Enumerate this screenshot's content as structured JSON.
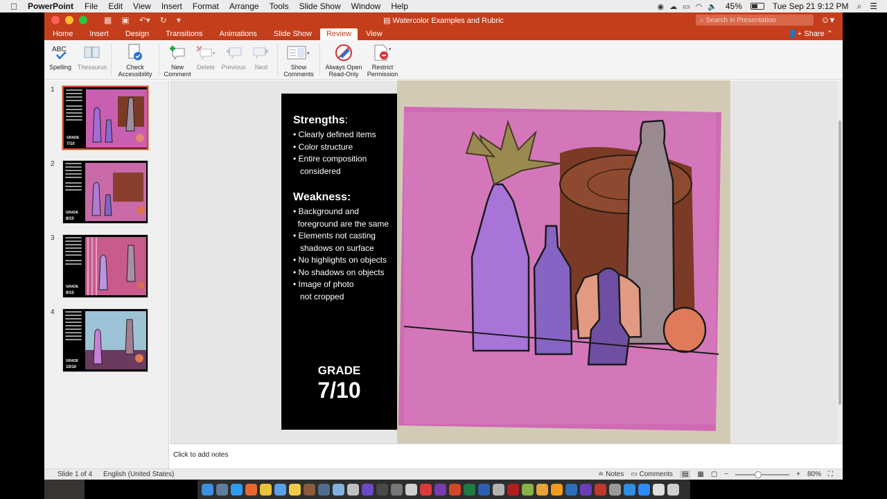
{
  "menubar": {
    "app_name": "PowerPoint",
    "items": [
      "File",
      "Edit",
      "View",
      "Insert",
      "Format",
      "Arrange",
      "Tools",
      "Slide Show",
      "Window",
      "Help"
    ],
    "battery": "45%",
    "datetime": "Tue Sep 21  9:12 PM"
  },
  "window": {
    "title": "Watercolor Examples and Rubric",
    "search_placeholder": "Search in Presentation"
  },
  "tabs": [
    "Home",
    "Insert",
    "Design",
    "Transitions",
    "Animations",
    "Slide Show",
    "Review",
    "View"
  ],
  "active_tab": "Review",
  "share_label": "Share",
  "ribbon": {
    "spelling": "Spelling",
    "thesaurus": "Thesaurus",
    "check_accessibility": [
      "Check",
      "Accessibility"
    ],
    "new_comment": [
      "New",
      "Comment"
    ],
    "delete": "Delete",
    "previous": "Previous",
    "next": "Next",
    "show_comments": [
      "Show",
      "Comments"
    ],
    "always_open": [
      "Always Open",
      "Read-Only"
    ],
    "restrict": [
      "Restrict",
      "Permission"
    ]
  },
  "thumbnails": [
    {
      "num": "1",
      "grade_label": "GRADE",
      "grade": "7/10"
    },
    {
      "num": "2",
      "grade_label": "GRADE",
      "grade": "8/10"
    },
    {
      "num": "3",
      "grade_label": "GRADE",
      "grade": "9/10"
    },
    {
      "num": "4",
      "grade_label": "GRADE",
      "grade": "10/10"
    }
  ],
  "slide": {
    "strengths_title": "Strengths",
    "strengths_colon": ":",
    "strengths": [
      "• Clearly defined items",
      "• Color structure",
      "• Entire composition",
      "   considered"
    ],
    "weakness_title": "Weakness:",
    "weaknesses": [
      "• Background and",
      "  foreground are the same",
      "• Elements not casting",
      "   shadows on surface",
      "• No highlights on objects",
      "• No shadows on objects",
      "• Image of photo",
      "   not cropped"
    ],
    "grade_label": "GRADE",
    "grade": "7/10"
  },
  "notes_placeholder": "Click to add notes",
  "status": {
    "slide": "Slide 1 of 4",
    "language": "English (United States)",
    "notes": "Notes",
    "comments": "Comments",
    "zoom": "80%"
  },
  "colors": {
    "accent": "#c43e1c",
    "painting_pink": "#d96cbf",
    "painting_brown": "#7b3a25"
  }
}
